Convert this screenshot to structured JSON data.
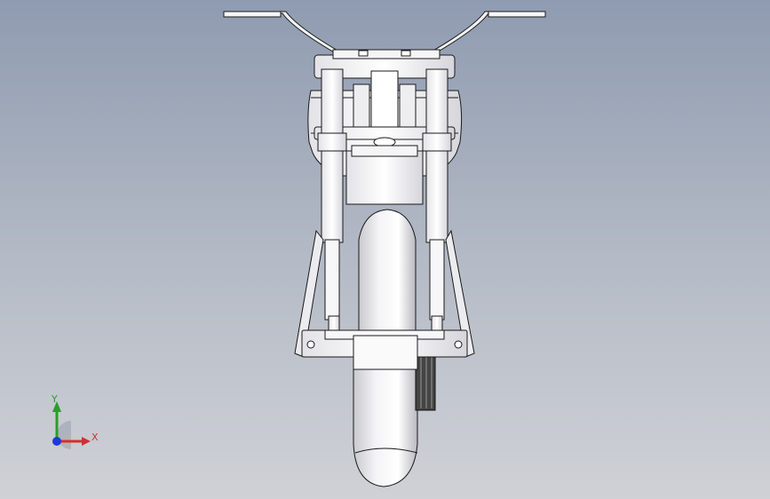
{
  "viewport": {
    "background_top": "#8f9bb0",
    "background_bottom": "#cfd1d6"
  },
  "model": {
    "name": "motorcycle-front-view"
  },
  "triad": {
    "y_label": "Y",
    "x_label": "X",
    "y_color": "#2a9d2a",
    "x_color": "#d03030",
    "z_color": "#1e3ad6"
  }
}
